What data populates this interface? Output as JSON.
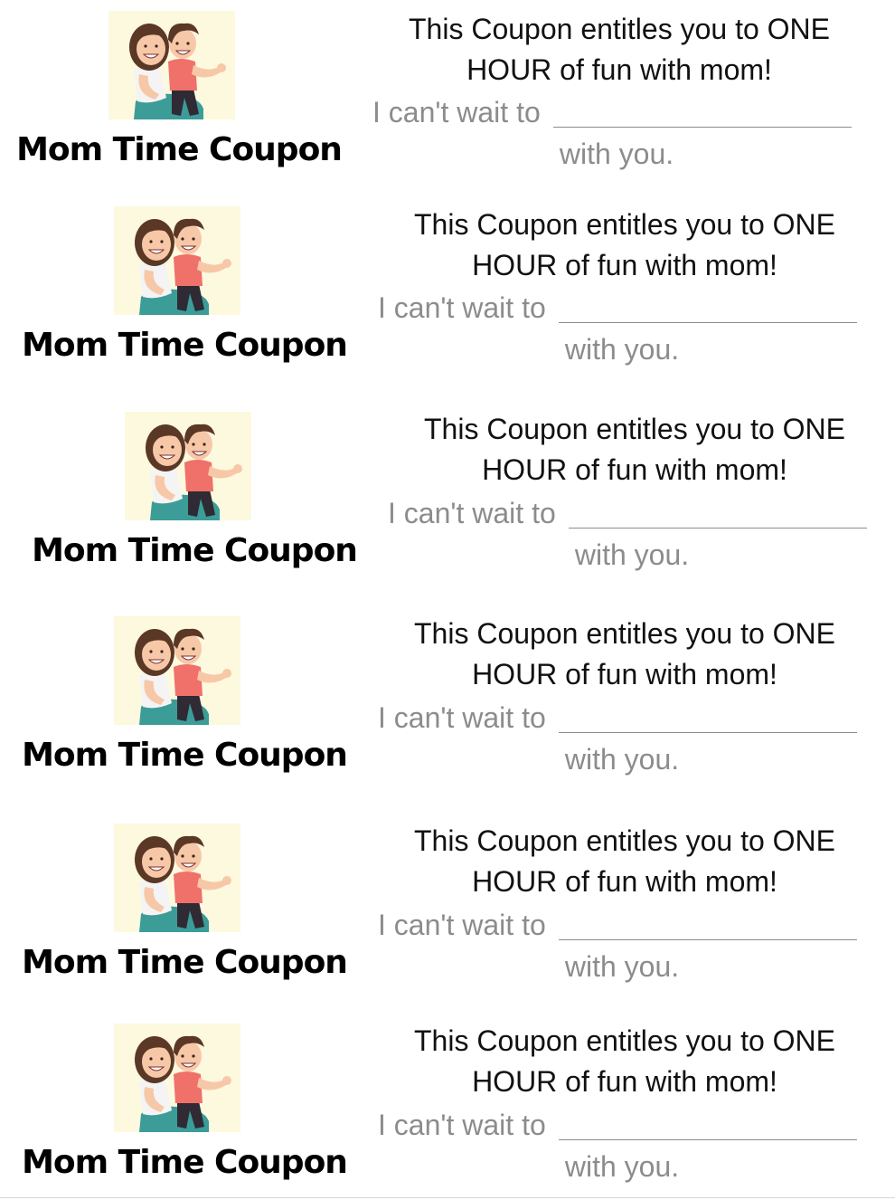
{
  "coupons": [
    {
      "title": "Mom Time Coupon",
      "line1": "This Coupon entitles you to ONE",
      "line2": "HOUR of fun with mom!",
      "fill_label": "I can't wait to",
      "closing": "with you.",
      "image": "mother-and-son-illustration"
    },
    {
      "title": "Mom Time Coupon",
      "line1": "This Coupon entitles you to ONE",
      "line2": "HOUR of fun with mom!",
      "fill_label": "I can't wait to",
      "closing": "with you.",
      "image": "mother-and-son-illustration"
    },
    {
      "title": "Mom Time Coupon",
      "line1": "This Coupon entitles you to ONE",
      "line2": "HOUR of fun with mom!",
      "fill_label": "I can't wait to",
      "closing": "with you.",
      "image": "mother-and-son-illustration"
    },
    {
      "title": "Mom Time Coupon",
      "line1": "This Coupon entitles you to ONE",
      "line2": "HOUR of fun with mom!",
      "fill_label": "I can't wait to",
      "closing": "with you.",
      "image": "mother-and-son-illustration"
    },
    {
      "title": "Mom Time Coupon",
      "line1": "This Coupon entitles you to ONE",
      "line2": "HOUR of fun with mom!",
      "fill_label": "I can't wait to",
      "closing": "with you.",
      "image": "mother-and-son-illustration"
    },
    {
      "title": "Mom Time Coupon",
      "line1": "This Coupon entitles you to ONE",
      "line2": "HOUR of fun with mom!",
      "fill_label": "I can't wait to",
      "closing": "with you.",
      "image": "mother-and-son-illustration"
    }
  ],
  "colors": {
    "illustration_bg": "#fdf9df",
    "hair": "#5a3825",
    "skin": "#f7c8a8",
    "boy_shirt": "#f0706a",
    "mom_top": "#f4f4f4",
    "mom_pants": "#3c9c98",
    "muted_text": "#8c8c8c"
  }
}
